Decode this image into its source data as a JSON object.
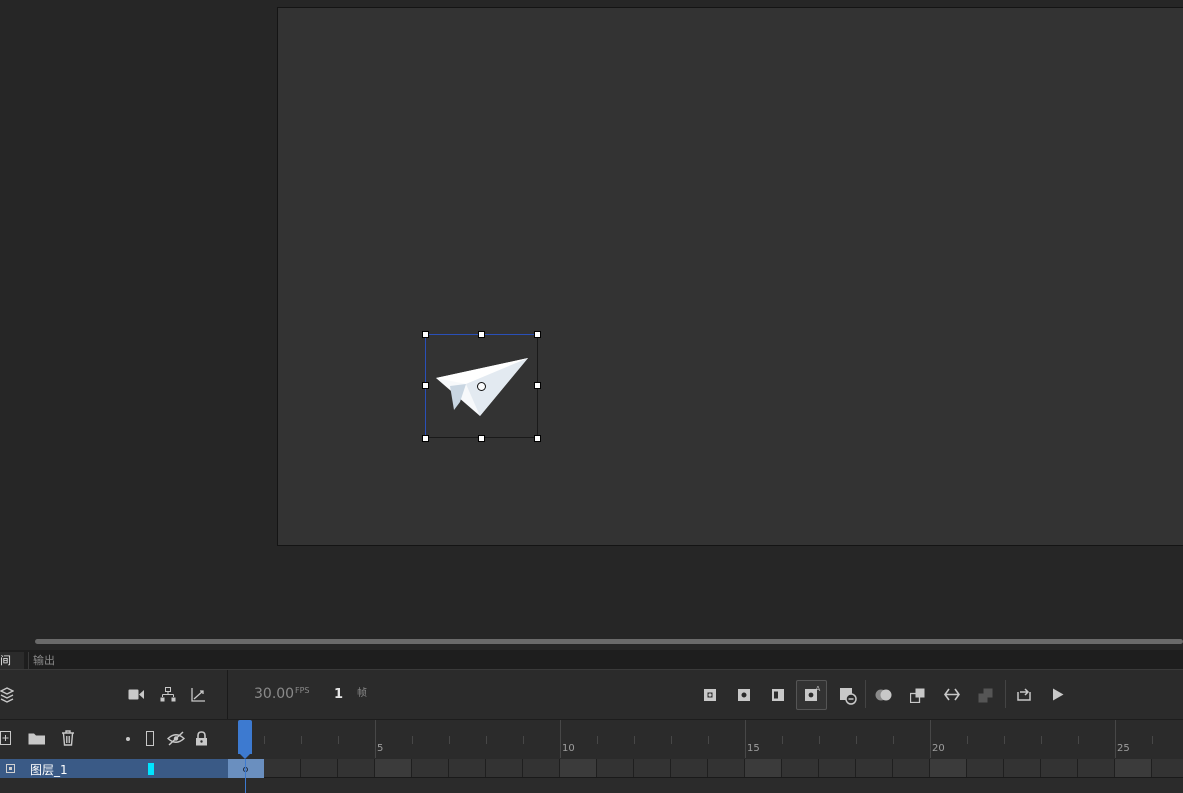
{
  "panel": {
    "tabs": [
      {
        "label": "间轴",
        "active": true
      },
      {
        "label": "输出",
        "active": false
      }
    ]
  },
  "timeline": {
    "fps_value": "30.00",
    "fps_unit": "FPS",
    "current_frame": "1",
    "frame_unit": "帧",
    "ruler_labels": [
      "5",
      "10",
      "15",
      "20",
      "25"
    ]
  },
  "layers": [
    {
      "name": "图层_1",
      "color": "#00e5ff",
      "selected": true
    }
  ],
  "icons": {
    "left_toolbar": [
      "layers-icon",
      "camera-icon",
      "parenting-icon",
      "graph-icon"
    ],
    "layer_header": [
      "new-layer-icon",
      "new-folder-icon",
      "delete-icon",
      "dot-icon",
      "outline-icon",
      "visibility-icon",
      "lock-icon"
    ],
    "frame_toolbar": [
      "onion-skin-icon",
      "onion-outline-icon",
      "edit-multiple-icon",
      "auto-keyframe-icon",
      "remove-frame-icon",
      "tween-icon",
      "convert-icon",
      "swap-icon",
      "paste-icon",
      "loop-icon",
      "play-icon"
    ]
  },
  "colors": {
    "accent": "#3d7ad0",
    "layer_highlight": "#3a5a86",
    "stage": "#333333",
    "workspace": "#262626"
  }
}
